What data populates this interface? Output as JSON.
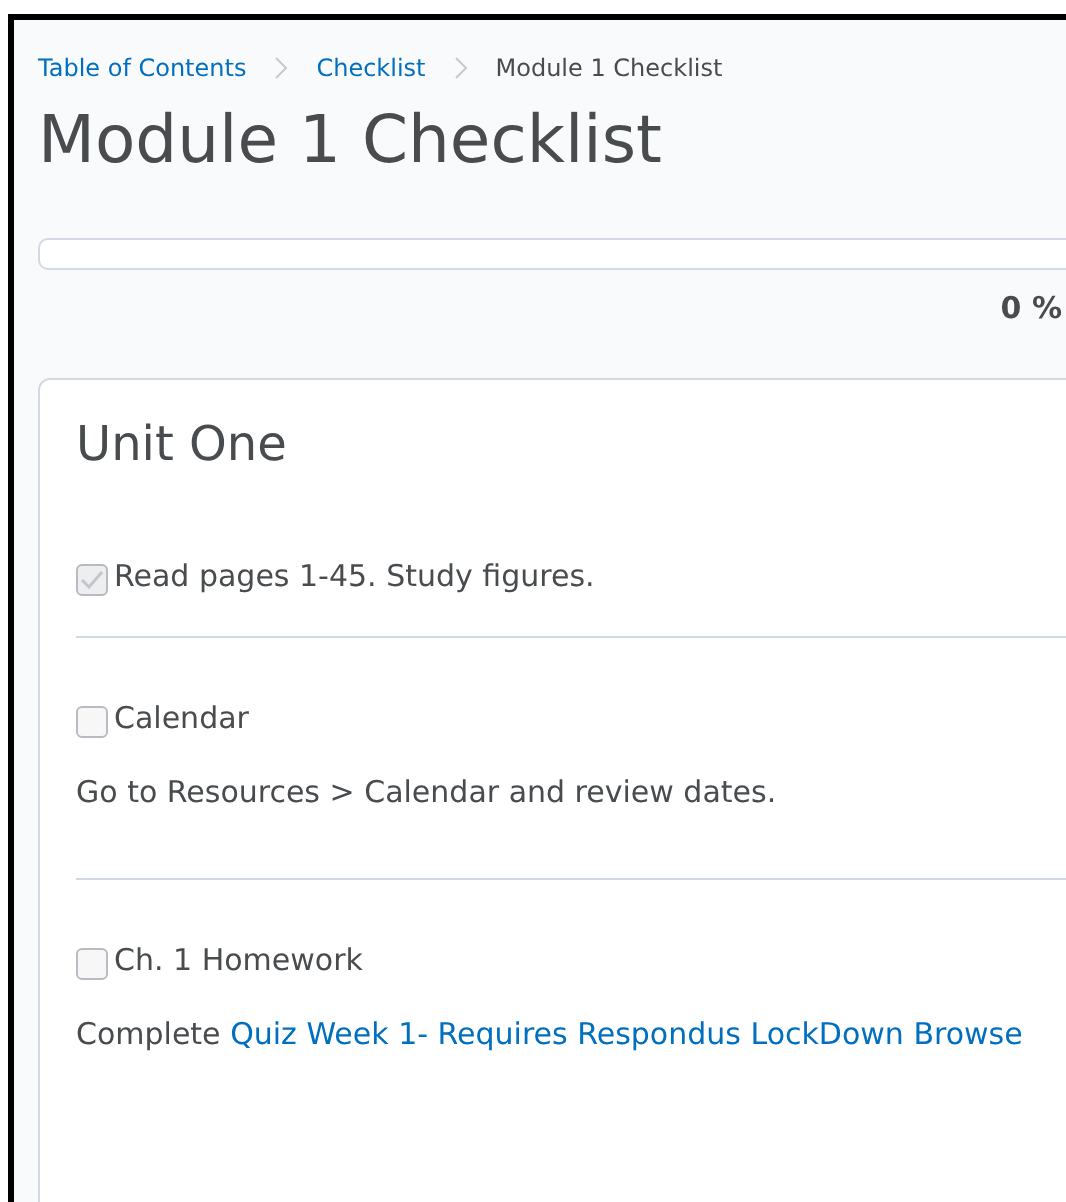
{
  "breadcrumbs": [
    {
      "label": "Table of Contents",
      "kind": "link"
    },
    {
      "label": "Checklist",
      "kind": "link"
    },
    {
      "label": "Module 1 Checklist",
      "kind": "current"
    }
  ],
  "title": "Module 1 Checklist",
  "progress": {
    "level": 0,
    "reading": "0 %"
  },
  "category": {
    "title": "Unit One",
    "items": [
      {
        "label": "Read pages 1-45. Study figures.",
        "checked": true
      },
      {
        "label": "Calendar",
        "checked": false,
        "description": {
          "text": "Go to Resources > Calendar and review dates."
        }
      },
      {
        "label": "Ch. 1 Homework",
        "checked": false,
        "description": {
          "text": "Complete",
          "link": "Quiz Week 1- Requires Respondus LockDown Browse"
        }
      }
    ]
  }
}
